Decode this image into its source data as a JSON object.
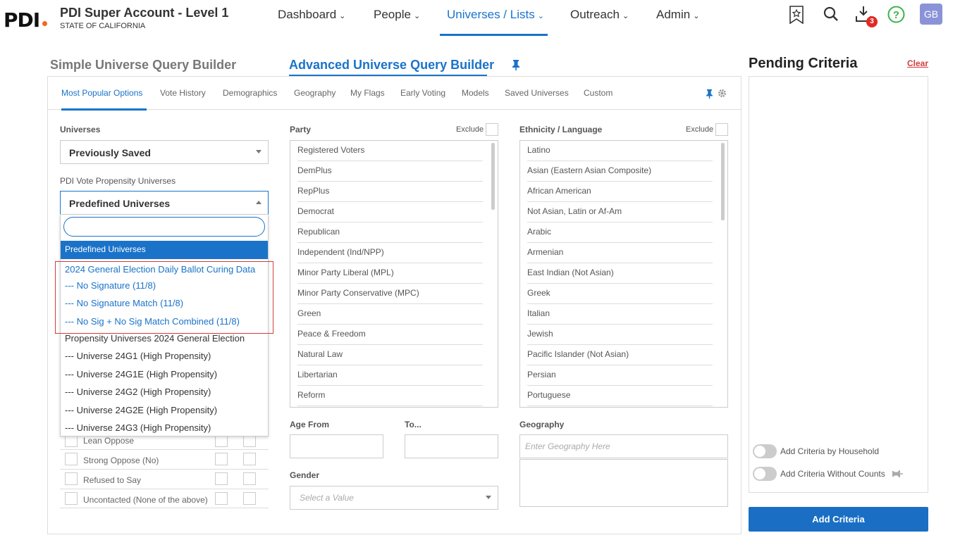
{
  "app": {
    "logo": "PDI",
    "account": "PDI Super Account - Level 1",
    "state": "STATE OF CALIFORNIA"
  },
  "nav": {
    "items": [
      {
        "label": "Dashboard"
      },
      {
        "label": "People"
      },
      {
        "label": "Universes / Lists"
      },
      {
        "label": "Outreach"
      },
      {
        "label": "Admin"
      }
    ],
    "badge_count": "3",
    "avatar": "GB"
  },
  "builder": {
    "simple_title": "Simple Universe Query Builder",
    "advanced_title": "Advanced Universe Query Builder"
  },
  "tabs": [
    "Most Popular Options",
    "Vote History",
    "Demographics",
    "Geography",
    "My Flags",
    "Early Voting",
    "Models",
    "Saved Universes",
    "Custom"
  ],
  "universes": {
    "label": "Universes",
    "value": "Previously Saved"
  },
  "propensity": {
    "label": "PDI Vote Propensity Universes",
    "value": "Predefined Universes",
    "search_value": "",
    "options": [
      "Predefined Universes",
      "2024 General Election Daily Ballot Curing Data",
      "--- No Signature (11/8)",
      "--- No Signature Match (11/8)",
      "--- No Sig + No Sig Match Combined (11/8)",
      "Propensity Universes 2024 General Election",
      "--- Universe 24G1 (High Propensity)",
      "--- Universe 24G1E (High Propensity)",
      "--- Universe 24G2 (High Propensity)",
      "--- Universe 24G2E (High Propensity)",
      "--- Universe 24G3 (High Propensity)"
    ]
  },
  "support_rows": [
    "Lean Oppose",
    "Strong Oppose (No)",
    "Refused to Say",
    "Uncontacted (None of the above)"
  ],
  "party": {
    "label": "Party",
    "exclude": "Exclude",
    "items": [
      "Registered Voters",
      "DemPlus",
      "RepPlus",
      "Democrat",
      "Republican",
      "Independent (Ind/NPP)",
      "Minor Party Liberal (MPL)",
      "Minor Party Conservative (MPC)",
      "Green",
      "Peace & Freedom",
      "Natural Law",
      "Libertarian",
      "Reform"
    ]
  },
  "ethnicity": {
    "label": "Ethnicity / Language",
    "exclude": "Exclude",
    "items": [
      "Latino",
      "Asian (Eastern Asian Composite)",
      "African American",
      "Not Asian, Latin or Af-Am",
      "Arabic",
      "Armenian",
      "East Indian (Not Asian)",
      "Greek",
      "Italian",
      "Jewish",
      "Pacific Islander (Not Asian)",
      "Persian",
      "Portuguese"
    ]
  },
  "age": {
    "from_label": "Age From",
    "to_label": "To..."
  },
  "gender": {
    "label": "Gender",
    "placeholder": "Select a Value"
  },
  "geography": {
    "label": "Geography",
    "placeholder": "Enter Geography Here"
  },
  "pending": {
    "title": "Pending Criteria",
    "clear": "Clear",
    "toggle_household": "Add Criteria by Household",
    "toggle_without_counts": "Add Criteria Without Counts",
    "add_button": "Add Criteria"
  },
  "colors": {
    "accent": "#1a73c9",
    "badge": "#e02b27",
    "highlight_box": "#d43c3c"
  }
}
